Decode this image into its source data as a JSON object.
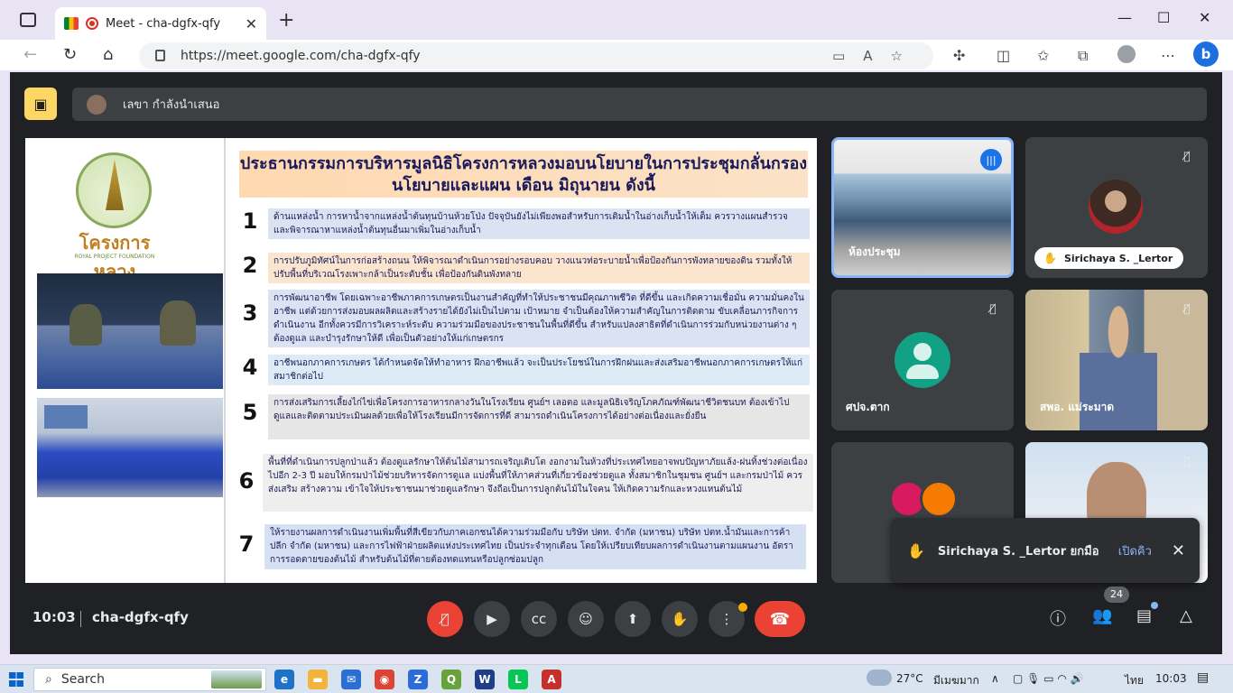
{
  "browser": {
    "tab_title": "Meet - cha-dgfx-qfy",
    "tab_close": "✕",
    "new_tab": "+",
    "url": "https://meet.google.com/cha-dgfx-qfy",
    "window_controls": [
      "—",
      "☐",
      "✕"
    ]
  },
  "meet": {
    "presenter_label": "เลขา กำลังนำเสนอ",
    "slide": {
      "logo_text": "โครงการหลวง",
      "logo_subtext": "ROYAL PROJECT FOUNDATION",
      "headline": "ประธานกรรมการบริหารมูลนิธิโครงการหลวงมอบนโยบายในการประชุมกลั่นกรองนโยบายและแผน เดือน มิถุนายน  ดังนี้",
      "items": [
        {
          "num": "1",
          "text": "ด้านแหล่งน้ำ การหาน้ำจากแหล่งน้ำต้นทุนบ้านห้วยโป่ง ปัจจุบันยังไม่เพียงพอสำหรับการเติมน้ำในอ่างเก็บน้ำให้เต็ม ควรวางแผนสำรวจ และพิจารณาหาแหล่งน้ำต้นทุนอื่นมาเพิ่มในอ่างเก็บน้ำ",
          "color": "#dbe3f3"
        },
        {
          "num": "2",
          "text": "การปรับภูมิทัศน์ในการก่อสร้างถนน  ให้พิจารณาดำเนินการอย่างรอบคอบ     วางแนวท่อระบายน้ำเพื่อป้องกันการพังทลายของดิน  รวมทั้งให้ปรับพื้นที่บริเวณโรงเพาะกล้าเป็นระดับชั้น เพื่อป้องกันดินพังทลาย",
          "color": "#fbe5cf"
        },
        {
          "num": "3",
          "text": "การพัฒนาอาชีพ โดยเฉพาะอาชีพภาคการเกษตรเป็นงานสำคัญที่ทำให้ประชาชนมีคุณภาพชีวิต ที่ดีขึ้น และเกิดความเชื่อมั่น ความมั่นคงในอาชีพ แต่ด้วยการส่งมอบผลผลิตและสร้างรายได้ยังไม่เป็นไปตาม เป้าหมาย จำเป็นต้องให้ความสำคัญในการติดตาม ขับเคลื่อนภารกิจการดำเนินงาน อีกทั้งควรมีการวิเคราะห์ระดับ ความร่วมมือของประชาชนในพื้นที่ดีขึ้น สำหรับแปลงสาธิตที่ดำเนินการร่วมกับหน่วยงานต่าง ๆต้องดูแล  และบำรุงรักษาให้ดี เพื่อเป็นตัวอย่างให้แก่เกษตรกร",
          "color": "#dbe3f3"
        },
        {
          "num": "4",
          "text": "อาชีพนอกภาคการเกษตร ได้กำหนดจัดให้ทำอาหาร ฝึกอาชีพแล้ว จะเป็นประโยชน์ในการฝึกฝนและส่งเสริมอาชีพนอกภาคการเกษตรให้แก่สมาชิกต่อไป",
          "color": "#dcebf5"
        },
        {
          "num": "5",
          "text": "การส่งเสริมการเลี้ยงไก่ไข่เพื่อโครงการอาหารกลางวันในโรงเรียน ศูนย์ฯ เลอตอ และมูลนิธิเจริญโภคภัณฑ์พัฒนาชีวิตชนบท  ต้องเข้าไปดูแลและติดตามประเมินผลด้วยเพื่อให้โรงเรียนมีการจัดการที่ดี สามารถดำเนินโครงการได้อย่างต่อเนื่องและยั่งยืน",
          "color": "#e6e6e6"
        },
        {
          "num": "6",
          "text": "พื้นที่ที่ดำเนินการปลูกป่าแล้ว ต้องดูแลรักษาให้ต้นไม้สามารถเจริญเติบโต      งอกงามในห้วงที่ประเทศไทยอาจพบปัญหาภัยแล้ง-ฝนทิ้งช่วงต่อเนื่องไปอีก 2-3 ปี มอบให้กรมป่าไม้ช่วยบริหารจัดการดูแล แบ่งพื้นที่ให้ภาคส่วนที่เกี่ยวข้องช่วยดูแล ทั้งสมาชิกในชุมชน ศูนย์ฯ และกรมป่าไม้ ควรส่งเสริม สร้างความ เข้าใจให้ประชาชนมาช่วยดูแลรักษา จึงถือเป็นการปลูกต้นไม้ในใจคน ให้เกิดความรักและหวงแหนต้นไม้",
          "color": "#eeeeee"
        },
        {
          "num": "7",
          "text": "ให้รายงานผลการดำเนินงานเพิ่มพื้นที่สีเขียวกับภาคเอกชนได้ความร่วมมือกับ บริษัท ปตท. จำกัด (มหาชน) บริษัท ปตท.น้ำมันและการค้าปลีก จำกัด (มหาชน) และการไฟฟ้าฝ่ายผลิตแห่งประเทศไทย เป็นประจำทุกเดือน โดยให้เปรียบเทียบผลการดำเนินงานตามแผนงาน อัตราการรอดตายของต้นไม้ สำหรับต้นไม้ที่ตายต้องทดแทนหรือปลูกซ่อมปลูก",
          "color": "#d6e0f3"
        }
      ]
    },
    "tiles": {
      "room_label": "ห้องประชุม",
      "sirichaya_label": "Sirichaya S. _Lertor",
      "sorpj_label": "ศปจ.ตาก",
      "sorpor_label": "สพอ. แม่ระมาด"
    },
    "toast": {
      "text": "Sirichaya S. _Lertor ยกมือ",
      "action": "เปิดคิว",
      "close": "✕"
    },
    "bottom": {
      "time": "10:03",
      "meeting_code": "cha-dgfx-qfy",
      "participant_count": "24"
    }
  },
  "taskbar": {
    "search_placeholder": "Search",
    "temperature": "27°C",
    "weather_text": "มีเมฆมาก",
    "language": "ไทย",
    "time": "10:03"
  },
  "colors": {
    "accent_yellow": "#fdd663",
    "danger_red": "#ea4335",
    "meet_bg": "#202124",
    "tile_bg": "#3c4043",
    "active_blue": "#8ab4f8"
  }
}
